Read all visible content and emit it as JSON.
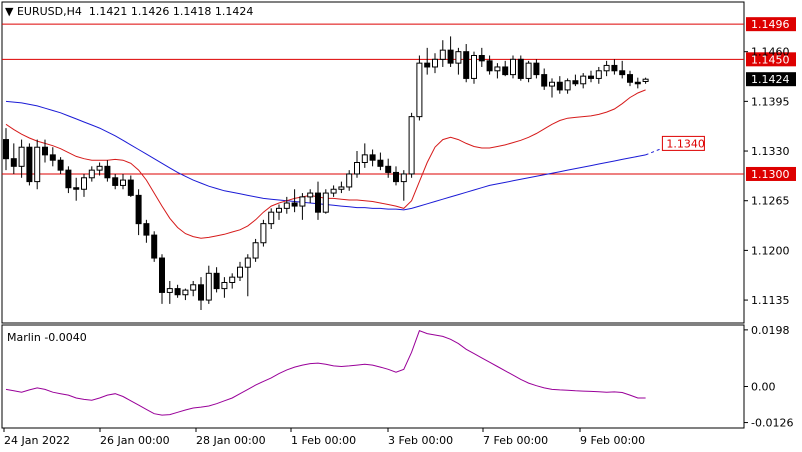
{
  "symbol": "EURUSD,H4",
  "ohlc": {
    "open": "1.1421",
    "high": "1.1426",
    "low": "1.1418",
    "close": "1.1424"
  },
  "colors": {
    "bull_fill": "#ffffff",
    "bear_fill": "#000000",
    "candle_outline": "#000000",
    "hline": "#dd0000",
    "ma_slow": "#1b1bd6",
    "ma_fast": "#d61b1b",
    "marlin": "#990099",
    "grid": "#c8c8c8",
    "frame": "#000000"
  },
  "price_axis_labels": [
    "1.1460",
    "1.1395",
    "1.1330",
    "1.1265",
    "1.1200",
    "1.1135"
  ],
  "levels": [
    {
      "value": 1.1496,
      "label": "1.1496"
    },
    {
      "value": 1.145,
      "label": "1.1450"
    },
    {
      "value": 1.13,
      "label": "1.1300"
    }
  ],
  "current_price": {
    "value": 1.1424,
    "label": "1.1424"
  },
  "target": {
    "value": 1.134,
    "label": "1.1340"
  },
  "time_labels": [
    "24 Jan 2022",
    "26 Jan 00:00",
    "28 Jan 00:00",
    "1 Feb 00:00",
    "3 Feb 00:00",
    "7 Feb 00:00",
    "9 Feb 00:00"
  ],
  "indicator": {
    "name": "Marlin -0.0040",
    "axis_labels": [
      "0.0198",
      "0.00",
      "-0.0126"
    ]
  },
  "chart_data": {
    "type": "candlestick",
    "y_range": [
      1.1105,
      1.1525
    ],
    "candles": [
      [
        1.1345,
        1.136,
        1.1305,
        1.132
      ],
      [
        1.132,
        1.134,
        1.13,
        1.131
      ],
      [
        1.131,
        1.1345,
        1.1295,
        1.1335
      ],
      [
        1.1335,
        1.134,
        1.1285,
        1.129
      ],
      [
        1.129,
        1.1345,
        1.128,
        1.1335
      ],
      [
        1.1335,
        1.1345,
        1.1315,
        1.1325
      ],
      [
        1.1325,
        1.1335,
        1.131,
        1.1318
      ],
      [
        1.1318,
        1.1322,
        1.13,
        1.1305
      ],
      [
        1.1305,
        1.131,
        1.1275,
        1.1282
      ],
      [
        1.1282,
        1.1295,
        1.1265,
        1.128
      ],
      [
        1.128,
        1.13,
        1.127,
        1.1295
      ],
      [
        1.1295,
        1.131,
        1.129,
        1.1305
      ],
      [
        1.1305,
        1.1315,
        1.1298,
        1.131
      ],
      [
        1.131,
        1.1318,
        1.129,
        1.1295
      ],
      [
        1.1295,
        1.13,
        1.128,
        1.1285
      ],
      [
        1.1285,
        1.13,
        1.128,
        1.1292
      ],
      [
        1.1292,
        1.1298,
        1.127,
        1.1272
      ],
      [
        1.1272,
        1.128,
        1.122,
        1.1235
      ],
      [
        1.1235,
        1.124,
        1.121,
        1.122
      ],
      [
        1.122,
        1.1225,
        1.1185,
        1.119
      ],
      [
        1.119,
        1.1195,
        1.113,
        1.1145
      ],
      [
        1.1145,
        1.116,
        1.113,
        1.115
      ],
      [
        1.115,
        1.1155,
        1.1138,
        1.1142
      ],
      [
        1.1142,
        1.115,
        1.1135,
        1.1148
      ],
      [
        1.1148,
        1.116,
        1.114,
        1.1155
      ],
      [
        1.1155,
        1.1165,
        1.1122,
        1.1135
      ],
      [
        1.1135,
        1.118,
        1.113,
        1.117
      ],
      [
        1.117,
        1.1178,
        1.1145,
        1.115
      ],
      [
        1.115,
        1.1165,
        1.1138,
        1.1158
      ],
      [
        1.1158,
        1.117,
        1.115,
        1.1165
      ],
      [
        1.1165,
        1.1185,
        1.116,
        1.1178
      ],
      [
        1.1178,
        1.1195,
        1.114,
        1.119
      ],
      [
        1.119,
        1.1215,
        1.1185,
        1.121
      ],
      [
        1.121,
        1.124,
        1.1205,
        1.1235
      ],
      [
        1.1235,
        1.1255,
        1.1228,
        1.125
      ],
      [
        1.125,
        1.126,
        1.124,
        1.1255
      ],
      [
        1.1255,
        1.127,
        1.1248,
        1.1262
      ],
      [
        1.1262,
        1.128,
        1.125,
        1.1258
      ],
      [
        1.1258,
        1.1275,
        1.124,
        1.127
      ],
      [
        1.127,
        1.128,
        1.1262,
        1.1275
      ],
      [
        1.1275,
        1.129,
        1.124,
        1.125
      ],
      [
        1.125,
        1.128,
        1.1248,
        1.1275
      ],
      [
        1.1275,
        1.1285,
        1.127,
        1.128
      ],
      [
        1.128,
        1.129,
        1.1275,
        1.1283
      ],
      [
        1.1283,
        1.1305,
        1.1278,
        1.13
      ],
      [
        1.13,
        1.133,
        1.1295,
        1.1315
      ],
      [
        1.1315,
        1.134,
        1.1308,
        1.1325
      ],
      [
        1.1325,
        1.1332,
        1.131,
        1.1318
      ],
      [
        1.1318,
        1.1328,
        1.1305,
        1.131
      ],
      [
        1.131,
        1.132,
        1.1295,
        1.1302
      ],
      [
        1.1302,
        1.131,
        1.1285,
        1.129
      ],
      [
        1.129,
        1.1305,
        1.1265,
        1.13
      ],
      [
        1.13,
        1.138,
        1.1295,
        1.1375
      ],
      [
        1.1375,
        1.1455,
        1.137,
        1.1445
      ],
      [
        1.1445,
        1.1465,
        1.143,
        1.144
      ],
      [
        1.144,
        1.1458,
        1.1432,
        1.145
      ],
      [
        1.145,
        1.1475,
        1.144,
        1.1462
      ],
      [
        1.1462,
        1.148,
        1.144,
        1.1445
      ],
      [
        1.1445,
        1.1465,
        1.143,
        1.146
      ],
      [
        1.146,
        1.147,
        1.142,
        1.1425
      ],
      [
        1.1425,
        1.146,
        1.1418,
        1.1455
      ],
      [
        1.1455,
        1.1465,
        1.144,
        1.1448
      ],
      [
        1.1448,
        1.1455,
        1.143,
        1.1435
      ],
      [
        1.1435,
        1.1445,
        1.1425,
        1.144
      ],
      [
        1.144,
        1.1448,
        1.1428,
        1.143
      ],
      [
        1.143,
        1.1455,
        1.1425,
        1.145
      ],
      [
        1.145,
        1.1455,
        1.1422,
        1.1425
      ],
      [
        1.1425,
        1.1448,
        1.142,
        1.1445
      ],
      [
        1.1445,
        1.145,
        1.1425,
        1.143
      ],
      [
        1.143,
        1.1438,
        1.141,
        1.1415
      ],
      [
        1.1415,
        1.1425,
        1.14,
        1.142
      ],
      [
        1.142,
        1.1428,
        1.1405,
        1.141
      ],
      [
        1.141,
        1.1425,
        1.1405,
        1.1422
      ],
      [
        1.1422,
        1.143,
        1.1415,
        1.1418
      ],
      [
        1.1418,
        1.1432,
        1.1412,
        1.1428
      ],
      [
        1.1428,
        1.1435,
        1.142,
        1.1425
      ],
      [
        1.1425,
        1.144,
        1.1418,
        1.1435
      ],
      [
        1.1435,
        1.1448,
        1.1428,
        1.1442
      ],
      [
        1.1442,
        1.145,
        1.143,
        1.1435
      ],
      [
        1.1435,
        1.1448,
        1.1425,
        1.143
      ],
      [
        1.143,
        1.1435,
        1.1415,
        1.142
      ],
      [
        1.142,
        1.1426,
        1.1412,
        1.1418
      ],
      [
        1.1421,
        1.1426,
        1.1418,
        1.1424
      ]
    ],
    "ma_slow": [
      1.1395,
      1.1394,
      1.1393,
      1.1391,
      1.1389,
      1.1386,
      1.1383,
      1.138,
      1.1376,
      1.1372,
      1.1368,
      1.1364,
      1.136,
      1.1355,
      1.135,
      1.1344,
      1.1338,
      1.1332,
      1.1326,
      1.132,
      1.1314,
      1.1308,
      1.1302,
      1.1297,
      1.1292,
      1.1288,
      1.1284,
      1.1281,
      1.1278,
      1.1276,
      1.1274,
      1.1272,
      1.127,
      1.1268,
      1.1267,
      1.1266,
      1.1265,
      1.1264,
      1.1263,
      1.1262,
      1.1261,
      1.126,
      1.1259,
      1.1258,
      1.1257,
      1.1256,
      1.1256,
      1.1255,
      1.1255,
      1.1254,
      1.1254,
      1.1253,
      1.1255,
      1.1258,
      1.1261,
      1.1264,
      1.1267,
      1.127,
      1.1273,
      1.1276,
      1.1279,
      1.1282,
      1.1285,
      1.1287,
      1.1289,
      1.1291,
      1.1293,
      1.1295,
      1.1297,
      1.1299,
      1.1301,
      1.1303,
      1.1305,
      1.1307,
      1.1309,
      1.1311,
      1.1313,
      1.1315,
      1.1317,
      1.1319,
      1.1321,
      1.1323,
      1.1325
    ],
    "ma_slow_projection": [
      1.1325,
      1.1329,
      1.1333,
      1.1337,
      1.1341,
      1.1344,
      1.1347
    ],
    "ma_fast": [
      1.1365,
      1.1358,
      1.1352,
      1.1347,
      1.1343,
      1.134,
      1.1337,
      1.1333,
      1.1328,
      1.1323,
      1.132,
      1.1318,
      1.1318,
      1.1318,
      1.1319,
      1.1318,
      1.1314,
      1.1305,
      1.1292,
      1.1275,
      1.1258,
      1.1242,
      1.123,
      1.1222,
      1.1218,
      1.1216,
      1.1217,
      1.1219,
      1.1221,
      1.1224,
      1.1227,
      1.1232,
      1.124,
      1.125,
      1.1258,
      1.1262,
      1.1265,
      1.1268,
      1.127,
      1.1272,
      1.127,
      1.1268,
      1.1268,
      1.1267,
      1.1266,
      1.1266,
      1.1265,
      1.1264,
      1.1262,
      1.126,
      1.1258,
      1.1255,
      1.1265,
      1.129,
      1.1315,
      1.1335,
      1.1345,
      1.1348,
      1.1345,
      1.134,
      1.1336,
      1.1334,
      1.1334,
      1.1336,
      1.1338,
      1.1341,
      1.1344,
      1.1348,
      1.1353,
      1.1359,
      1.1365,
      1.137,
      1.1373,
      1.1374,
      1.1375,
      1.1376,
      1.1378,
      1.1381,
      1.1385,
      1.1392,
      1.14,
      1.1406,
      1.141
    ],
    "marlin": [
      -0.001,
      -0.0015,
      -0.002,
      -0.0012,
      -0.0005,
      -0.001,
      -0.002,
      -0.0025,
      -0.003,
      -0.004,
      -0.0045,
      -0.0048,
      -0.004,
      -0.003,
      -0.0025,
      -0.0035,
      -0.005,
      -0.0065,
      -0.008,
      -0.0095,
      -0.01,
      -0.0098,
      -0.009,
      -0.0082,
      -0.0075,
      -0.0072,
      -0.0068,
      -0.006,
      -0.005,
      -0.004,
      -0.0025,
      -0.001,
      0.0005,
      0.0018,
      0.003,
      0.0045,
      0.0058,
      0.0068,
      0.0075,
      0.008,
      0.0082,
      0.0078,
      0.0072,
      0.007,
      0.0072,
      0.0075,
      0.0078,
      0.0075,
      0.0068,
      0.006,
      0.005,
      0.006,
      0.012,
      0.0195,
      0.0185,
      0.018,
      0.0175,
      0.0165,
      0.015,
      0.013,
      0.0115,
      0.01,
      0.0085,
      0.007,
      0.0055,
      0.004,
      0.0025,
      0.0012,
      0.0003,
      -0.0005,
      -0.001,
      -0.0012,
      -0.0013,
      -0.0015,
      -0.0016,
      -0.0017,
      -0.0018,
      -0.002,
      -0.0019,
      -0.0021,
      -0.003,
      -0.004,
      -0.004
    ],
    "indicator_range": [
      -0.0145,
      0.0215
    ]
  }
}
